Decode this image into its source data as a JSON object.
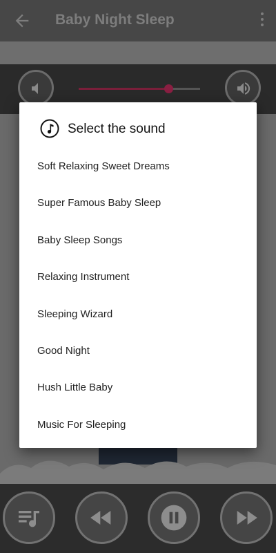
{
  "appbar": {
    "title": "Baby Night Sleep",
    "back_icon": "arrow-left-icon",
    "menu_icon": "more-vert-icon"
  },
  "volume": {
    "level": 0.74,
    "left_icon": "volume-down-icon",
    "right_icon": "volume-up-icon",
    "accent_color": "#8a1f42"
  },
  "dialog": {
    "icon": "music-note-icon",
    "title": "Select the sound",
    "options": [
      "Soft Relaxing Sweet Dreams",
      "Super Famous Baby Sleep",
      "Baby Sleep Songs",
      "Relaxing Instrument",
      "Sleeping Wizard",
      "Good Night",
      "Hush Little Baby",
      "Music For Sleeping"
    ]
  },
  "controls": {
    "playlist_icon": "playlist-icon",
    "rewind_icon": "rewind-icon",
    "pause_icon": "pause-icon",
    "forward_icon": "fast-forward-icon"
  }
}
